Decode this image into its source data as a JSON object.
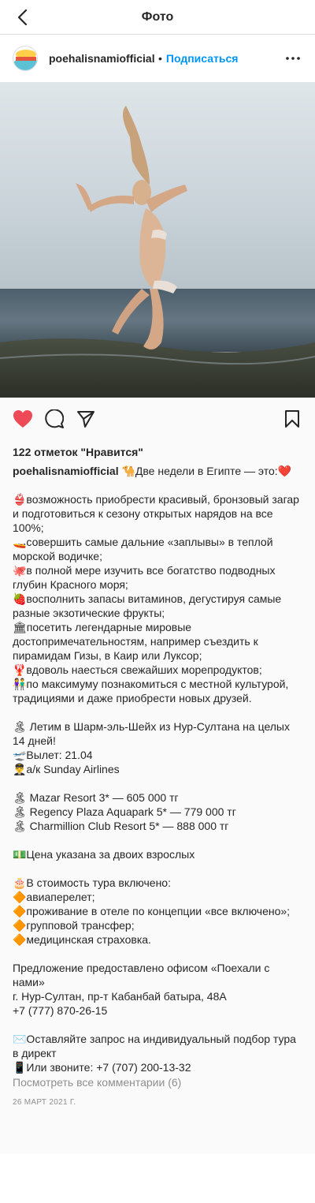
{
  "top_bar": {
    "title": "Фото"
  },
  "post": {
    "username": "poehalisnamiofficial",
    "dot": "•",
    "follow_label": "Подписаться",
    "avatar_text": "ПОЕХАЛИ С НАМИ",
    "likes": "122 отметок \"Нравится\"",
    "caption_lines": [
      "🐪Две недели в Египте — это:❤️",
      "",
      "👙возможность приобрести красивый, бронзовый загар и подготовиться к сезону открытых нарядов на все 100%;",
      "🚤совершить самые дальние «заплывы» в теплой морской водичке;",
      "🐙в полной мере изучить все богатство подводных глубин Красного моря;",
      "🍓восполнить запасы витаминов, дегустируя самые разные экзотические фрукты;",
      "🏛посетить легендарные мировые достопримечательностям, например съездить к пирамидам Гизы, в Каир или Луксор;",
      "🦞вдоволь наесться свежайших морепродуктов;",
      "👫по максимуму познакомиться с местной культурой, традициями и даже приобрести новых друзей.",
      "",
      "🏝 Летим в Шарм-эль-Шейх из Нур-Султана на целых 14 дней!",
      "🛫Вылет: 21.04",
      "👨‍✈️а/к Sunday Airlines",
      "",
      "🏝 Mazar Resort 3* — 605 000 тг",
      "🏝 Regency Plaza Aquapark 5* — 779 000 тг",
      "🏝 Charmillion Club Resort 5* — 888 000 тг",
      "",
      "💵Цена указана за двоих взрослых",
      "",
      "🎂В стоимость тура включено:",
      "🔶авиаперелет;",
      "🔶проживание в отеле по концепции «все включено»;",
      "🔶групповой трансфер;",
      "🔶медицинская страховка.",
      "",
      "Предложение предоставлено офисом «Поехали с нами»",
      "г. Нур-Султан, пр-т Кабанбай батыра, 48А",
      "+7 (777) 870-26-15",
      "",
      "✉️Оставляйте запрос на индивидуальный подбор тура в директ",
      "📱Или звоните: +7 (707) 200-13-32"
    ],
    "view_comments": "Посмотреть все комментарии (6)",
    "date": "26 МАРТ 2021 Г."
  },
  "colors": {
    "like_red": "#ed4956",
    "link_blue": "#0095f6",
    "muted": "#8e8e8e"
  },
  "icons": [
    "back-chevron-icon",
    "more-dots-icon",
    "heart-icon",
    "comment-icon",
    "share-icon",
    "bookmark-icon"
  ]
}
